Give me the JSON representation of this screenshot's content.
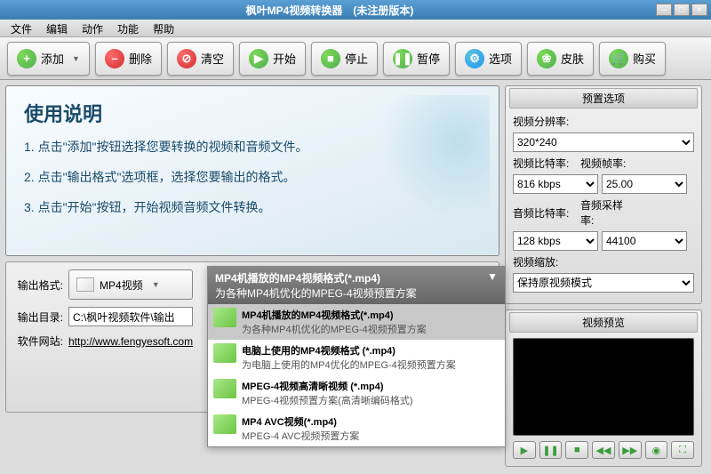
{
  "window": {
    "title": "枫叶MP4视频转换器　(未注册版本)"
  },
  "menu": {
    "file": "文件",
    "edit": "编辑",
    "action": "动作",
    "function": "功能",
    "help": "帮助"
  },
  "toolbar": {
    "add": "添加",
    "delete": "删除",
    "clear": "清空",
    "start": "开始",
    "stop": "停止",
    "pause": "暂停",
    "options": "选项",
    "skin": "皮肤",
    "buy": "购买"
  },
  "instructions": {
    "title": "使用说明",
    "line1": "1. 点击\"添加\"按钮选择您要转换的视频和音频文件。",
    "line2": "2. 点击\"输出格式\"选项框，选择您要输出的格式。",
    "line3": "3. 点击\"开始\"按钮，开始视频音频文件转换。"
  },
  "form": {
    "output_format_label": "输出格式:",
    "output_format_value": "MP4视频",
    "output_dir_label": "输出目录:",
    "output_dir_value": "C:\\枫叶视频软件\\输出",
    "website_label": "软件网站:",
    "website_value": "http://www.fengyesoft.com"
  },
  "format_dropdown": {
    "header_title": "MP4机播放的MP4视频格式(*.mp4)",
    "header_desc": "为各种MP4机优化的MPEG-4视频预置方案",
    "items": [
      {
        "title": "MP4机播放的MP4视频格式(*.mp4)",
        "desc": "为各种MP4机优化的MPEG-4视频预置方案",
        "selected": true
      },
      {
        "title": "电脑上使用的MP4视频格式 (*.mp4)",
        "desc": "为电脑上使用的MP4优化的MPEG-4视频预置方案",
        "selected": false
      },
      {
        "title": "MPEG-4视频高清晰视频 (*.mp4)",
        "desc": "MPEG-4视频预置方案(高清晰编码格式)",
        "selected": false
      },
      {
        "title": "MP4 AVC视频(*.mp4)",
        "desc": "MPEG-4 AVC视频预置方案",
        "selected": false
      }
    ]
  },
  "presets": {
    "panel_title": "预置选项",
    "resolution_label": "视频分辨率:",
    "resolution": "320*240",
    "vbitrate_label": "视频比特率:",
    "vbitrate": "816 kbps",
    "vframerate_label": "视频帧率:",
    "vframerate": "25.00",
    "abitrate_label": "音频比特率:",
    "abitrate": "128 kbps",
    "asamplerate_label": "音频采样率:",
    "asamplerate": "44100",
    "scaling_label": "视频缩放:",
    "scaling": "保持原视频模式"
  },
  "preview": {
    "panel_title": "视频预览"
  }
}
